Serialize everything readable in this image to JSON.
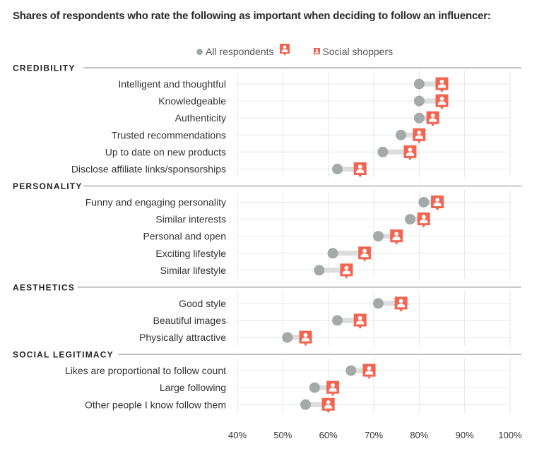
{
  "title": "Shares of respondents who rate the following as important when deciding to follow an influencer:",
  "colors": {
    "all_respondents": "#a3aaa8",
    "social_shoppers": "#f26552",
    "connector": "#dddddd",
    "gridline": "#e6e6e6",
    "section_rule": "#9aa09e"
  },
  "legend": {
    "all_respondents": "All respondents",
    "social_shoppers": "Social shoppers"
  },
  "chart_data": {
    "type": "scatter",
    "subtype": "dumbbell",
    "title": "Shares of respondents who rate the following as important when deciding to follow an influencer:",
    "xlabel": "",
    "ylabel": "",
    "xlim": [
      40,
      100
    ],
    "x_ticks": [
      40,
      50,
      60,
      70,
      80,
      90,
      100
    ],
    "x_tick_labels": [
      "40%",
      "50%",
      "60%",
      "70%",
      "80%",
      "90%",
      "100%"
    ],
    "grid": true,
    "legend_position": "top-center",
    "series_names": [
      "All respondents",
      "Social shoppers"
    ],
    "sections": [
      {
        "name": "CREDIBILITY",
        "rows": [
          {
            "label": "Intelligent and thoughtful",
            "all": 80,
            "shoppers": 85
          },
          {
            "label": "Knowledgeable",
            "all": 80,
            "shoppers": 85
          },
          {
            "label": "Authenticity",
            "all": 80,
            "shoppers": 83
          },
          {
            "label": "Trusted recommendations",
            "all": 76,
            "shoppers": 80
          },
          {
            "label": "Up to date on new products",
            "all": 72,
            "shoppers": 78
          },
          {
            "label": "Disclose affiliate links/sponsorships",
            "all": 62,
            "shoppers": 67
          }
        ]
      },
      {
        "name": "PERSONALITY",
        "rows": [
          {
            "label": "Funny and engaging personality",
            "all": 81,
            "shoppers": 84
          },
          {
            "label": "Similar interests",
            "all": 78,
            "shoppers": 81
          },
          {
            "label": "Personal and open",
            "all": 71,
            "shoppers": 75
          },
          {
            "label": "Exciting lifestyle",
            "all": 61,
            "shoppers": 68
          },
          {
            "label": "Similar lifestyle",
            "all": 58,
            "shoppers": 64
          }
        ]
      },
      {
        "name": "AESTHETICS",
        "rows": [
          {
            "label": "Good style",
            "all": 71,
            "shoppers": 76
          },
          {
            "label": "Beautiful images",
            "all": 62,
            "shoppers": 67
          },
          {
            "label": "Physically attractive",
            "all": 51,
            "shoppers": 55
          }
        ]
      },
      {
        "name": "SOCIAL LEGITIMACY",
        "rows": [
          {
            "label": "Likes are proportional to follow count",
            "all": 65,
            "shoppers": 69
          },
          {
            "label": "Large following",
            "all": 57,
            "shoppers": 61
          },
          {
            "label": "Other people I know follow them",
            "all": 55,
            "shoppers": 60
          }
        ]
      }
    ]
  }
}
